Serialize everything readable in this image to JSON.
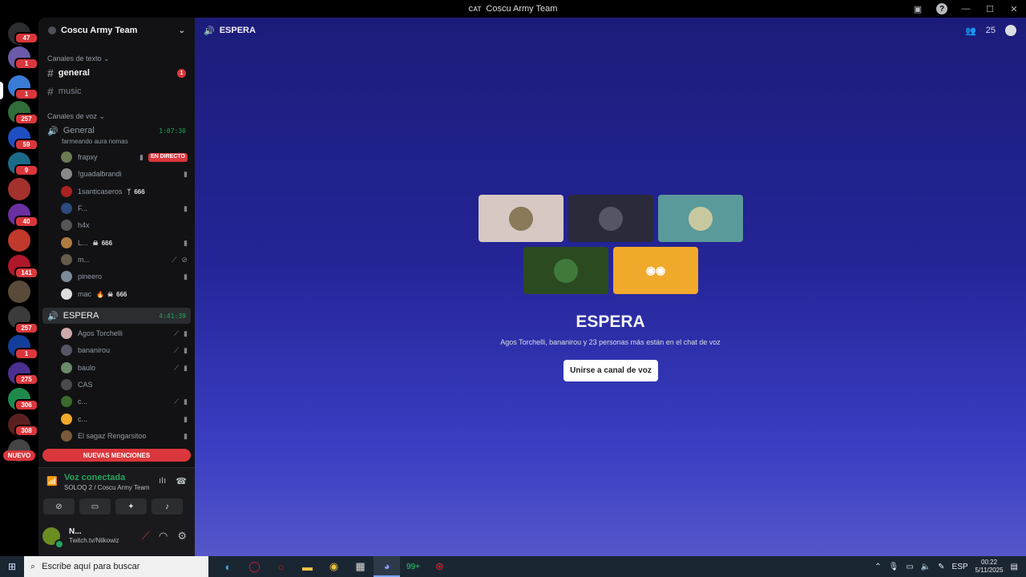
{
  "window": {
    "tag": "CAT",
    "title": "Coscu Army Team"
  },
  "servers": {
    "badges": [
      "47",
      "1",
      "1",
      "257",
      "59",
      "9",
      "40",
      "141",
      "257",
      "1",
      "275",
      "306",
      "308"
    ],
    "nuevo_label": "NUEVO"
  },
  "guild": {
    "name": "Coscu Army Team"
  },
  "text_category": "Canales de texto",
  "text_channels": [
    {
      "name": "general",
      "badge": "1"
    },
    {
      "name": "music"
    }
  ],
  "voice_category": "Canales de voz",
  "voice_general": {
    "name": "General",
    "time": "1:07:30",
    "status": "farmeando aura nomas",
    "users": [
      {
        "name": "frapxy",
        "tag": "EN DIRECTO"
      },
      {
        "name": "!guadalbrandi"
      },
      {
        "name": "1santicaseros",
        "tag": "666"
      },
      {
        "name": "F..."
      },
      {
        "name": "h4x"
      },
      {
        "name": "L...",
        "tag": "666"
      },
      {
        "name": "m..."
      },
      {
        "name": "pineero"
      },
      {
        "name": "mac",
        "tag": "666"
      }
    ]
  },
  "voice_espera": {
    "name": "ESPERA",
    "time": "4:41:39",
    "users": [
      {
        "name": "Agos Torchelli"
      },
      {
        "name": "bananirou"
      },
      {
        "name": "baulo"
      },
      {
        "name": "CAS"
      },
      {
        "name": "c..."
      },
      {
        "name": "c..."
      },
      {
        "name": "El sagaz Rengarsitoo"
      }
    ]
  },
  "mentions_label": "NUEVAS MENCIONES",
  "voice_panel": {
    "title": "Voz conectada",
    "subtitle": "SOLOQ 2 / Coscu Army Team"
  },
  "user_panel": {
    "name": "N...",
    "status": "Twitch.tv/Nilkowiz"
  },
  "main": {
    "channel_name": "ESPERA",
    "member_count": "25",
    "title": "ESPERA",
    "subtitle": "Agos Torchelli, bananirou y 23 personas más están en el chat de voz",
    "join_label": "Unirse a canal de voz"
  },
  "colors": {
    "accent_green": "#23a55a",
    "alert_red": "#da373c",
    "join_bg": "#ffffff",
    "tile_orange": "#f0a92a"
  },
  "taskbar": {
    "search_placeholder": "Escribe aquí para buscar",
    "whatsapp_badge": "99+",
    "lang": "ESP",
    "time": "00:22",
    "date": "5/11/2025"
  }
}
